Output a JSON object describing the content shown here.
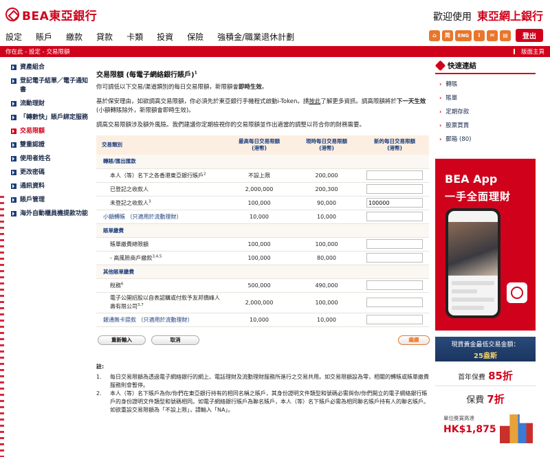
{
  "header": {
    "logo_text": "BEA東亞銀行",
    "welcome": "歡迎使用",
    "brand": "東亞網上銀行"
  },
  "nav": [
    "設定",
    "賬戶",
    "繳款",
    "貸款",
    "卡類",
    "投資",
    "保險",
    "強積金/職業退休計劃"
  ],
  "toolbar": {
    "icons": [
      "home-icon",
      "chinese-lang-icon",
      "eng-lang-icon",
      "info-icon",
      "mail-icon",
      "print-icon"
    ],
    "eng": "ENG",
    "i": "i",
    "logout": "登出"
  },
  "breadcrumb": "你在此 - 設定 - 交易限額",
  "home_link": "版面主頁",
  "sidebar": {
    "items": [
      {
        "label": "資產組合"
      },
      {
        "label": "登記電子結單／電子通知書"
      },
      {
        "label": "流動理財"
      },
      {
        "label": "「轉數快」賬戶綁定服務"
      },
      {
        "label": "交易限額",
        "active": true
      },
      {
        "label": "雙重認證"
      },
      {
        "label": "使用者姓名"
      },
      {
        "label": "更改密碼"
      },
      {
        "label": "通訊資料"
      },
      {
        "label": "賬戶管理"
      },
      {
        "label": "海外自動櫃員機提款功能"
      }
    ]
  },
  "content": {
    "title": "交易限額 (每電子網絡銀行賬戶)",
    "title_sup": "1",
    "p1_a": "你可調低以下交易/渠道類別的每日交易限額，新限額會",
    "p1_b": "即時生效",
    "p1_c": "。",
    "p2_a": "基於保安理由，如欲調高交易限額，你必須先於東亞銀行手機程式啟動i-Token。請",
    "p2_link": "按此",
    "p2_b": "了解更多資訊。調高限額將於",
    "p2_bold": "下一天生效",
    "p2_c": "(小額轉賬除外，新限額會即時生效)。",
    "p3": "調高交易限額涉及額外風險。我們建議你定期檢視你的交易限額並作出適當的調整以符合你的財務需要。"
  },
  "table": {
    "headers": [
      "交易類別",
      "最高每日交易限額\n(港幣)",
      "現時每日交易限額\n(港幣)",
      "新的每日交易限額\n(港幣)"
    ],
    "sec1": "轉賬/匯出匯款",
    "rows1": [
      {
        "label": "本人（等）名下之各香港東亞銀行賬戶",
        "sup": "2",
        "max": "不設上限",
        "cur": "200,000",
        "new": ""
      },
      {
        "label": "已登記之收款人",
        "sup": "",
        "max": "2,000,000",
        "cur": "200,300",
        "new": ""
      },
      {
        "label": "未登記之收款人",
        "sup": "3",
        "max": "100,000",
        "cur": "90,000",
        "new": "100000"
      }
    ],
    "small_transfer": {
      "label": "小額轉賬 （只適用於流動理財）",
      "max": "10,000",
      "cur": "10,000",
      "new": ""
    },
    "sec2": "賬單繳費",
    "rows2": [
      {
        "label": "賬單繳費總限額",
        "sup": "",
        "max": "100,000",
        "cur": "100,000",
        "new": ""
      },
      {
        "label": "- 高風險商戶繳款",
        "sup": "3,4,5",
        "max": "100,000",
        "cur": "80,000",
        "new": ""
      }
    ],
    "sec3": "其他賬單繳費",
    "rows3": [
      {
        "label": "稅務",
        "sup": "6",
        "max": "500,000",
        "cur": "490,000",
        "new": ""
      },
      {
        "label": "電子公開招股以自表認購或付款予友邦僑峰人壽有限公司",
        "sup": "3,7",
        "max": "2,000,000",
        "cur": "100,000",
        "new": ""
      }
    ],
    "cardless": {
      "label": "銀通無卡提款 （只適用於流動理財）",
      "max": "10,000",
      "cur": "10,000",
      "new": ""
    }
  },
  "buttons": {
    "reset": "重新輸入",
    "cancel": "取消",
    "next": "繼續"
  },
  "notes": {
    "heading": "註:",
    "items": [
      {
        "n": "1.",
        "text": "每日交易限額為透過電子網絡銀行的網上、電話理財及流動理財服務所進行之交易共用。如交易限額設為零，相關的轉賬或賬單繳費服務則會暫停。"
      },
      {
        "n": "2.",
        "text": "本人（等）名下賬戶為你/你們在東亞銀行持有的相同名稱之賬戶，其身份證明文件類型和號碼必需與你/你們開立的電子網絡銀行賬戶的身份證明文件類型和號碼相同。如電子網絡銀行賬戶為聯名賬戶，本人（等）名下賬戶必需為相同聯名賬戶持有人的聯名賬戶。如欲重設交易限額為「不設上限」，請輸入「NA」。"
      }
    ]
  },
  "quick_links": {
    "title": "快速連結",
    "items": [
      "轉賬",
      "賬單",
      "定期存款",
      "股票買賣",
      "郵箱 (80)"
    ]
  },
  "app_banner": {
    "line1": "BEA App",
    "line2": "一手全面理財"
  },
  "gold_banner": {
    "line1": "現貨黃金最低交易金額：",
    "line2": "25盎斯"
  },
  "promo1": {
    "a": "首年保費",
    "b": "85折"
  },
  "promo2": {
    "a": "保費",
    "b": "7折"
  },
  "price": {
    "label": "單位獎賞高達",
    "value": "HK$1,875"
  }
}
